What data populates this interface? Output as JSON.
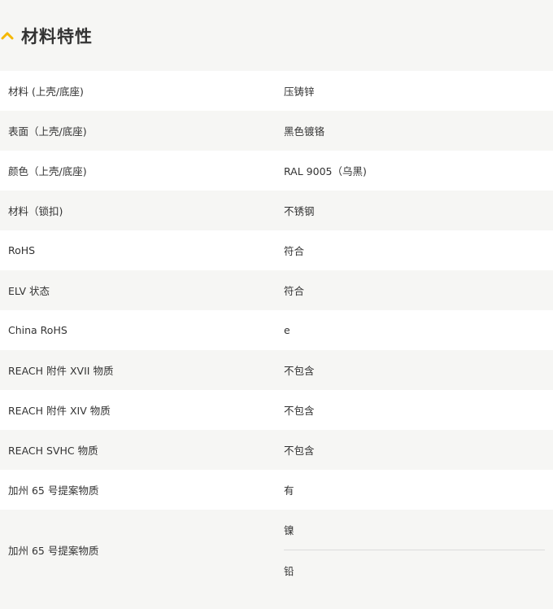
{
  "section": {
    "title": "材料特性",
    "icon": "chevron-up-icon",
    "accent_color": "#f5b800"
  },
  "rows": [
    {
      "label": "材料 (上壳/底座)",
      "value": "压铸锌"
    },
    {
      "label": "表面（上壳/底座)",
      "value": "黑色镀铬"
    },
    {
      "label": "颜色（上壳/底座)",
      "value": "RAL 9005（乌黑)"
    },
    {
      "label": "材料（锁扣)",
      "value": "不锈钢"
    },
    {
      "label": "RoHS",
      "value": "符合"
    },
    {
      "label": "ELV 状态",
      "value": "符合"
    },
    {
      "label": "China RoHS",
      "value": "e"
    },
    {
      "label": "REACH 附件 XVII 物质",
      "value": "不包含"
    },
    {
      "label": "REACH 附件 XIV 物质",
      "value": "不包含"
    },
    {
      "label": "REACH SVHC 物质",
      "value": "不包含"
    },
    {
      "label": "加州 65 号提案物质",
      "value": "有"
    }
  ],
  "multi_row": {
    "label": "加州 65 号提案物质",
    "values": [
      "镍",
      "铅"
    ]
  }
}
